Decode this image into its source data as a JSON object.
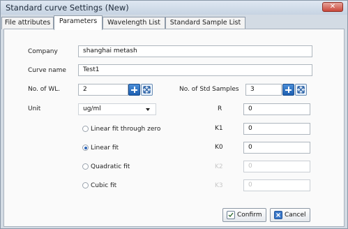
{
  "window": {
    "title": "Standard curve Settings (New)",
    "close_label": "✕"
  },
  "tabs": [
    "File attributes",
    "Parameters",
    "Wavelength List",
    "Standard Sample List"
  ],
  "form": {
    "company": {
      "label": "Company",
      "value": "shanghai metash"
    },
    "curve_name": {
      "label": "Curve name",
      "value": "Test1"
    },
    "no_wl": {
      "label": "No. of WL.",
      "value": "2"
    },
    "no_std": {
      "label": "No. of Std Samples",
      "value": "3"
    },
    "unit": {
      "label": "Unit",
      "value": "ug/ml"
    },
    "fits": [
      {
        "label": "Linear fit through zero",
        "selected": false
      },
      {
        "label": "Linear fit",
        "selected": true
      },
      {
        "label": "Quadratic fit",
        "selected": false
      },
      {
        "label": "Cubic fit",
        "selected": false
      }
    ],
    "params": [
      {
        "label": "R",
        "value": "0"
      },
      {
        "label": "K1",
        "value": "0"
      },
      {
        "label": "K0",
        "value": "0"
      },
      {
        "label": "K2",
        "value": "0"
      },
      {
        "label": "K3",
        "value": "0"
      }
    ]
  },
  "buttons": {
    "confirm": "Confirm",
    "cancel": "Cancel"
  }
}
